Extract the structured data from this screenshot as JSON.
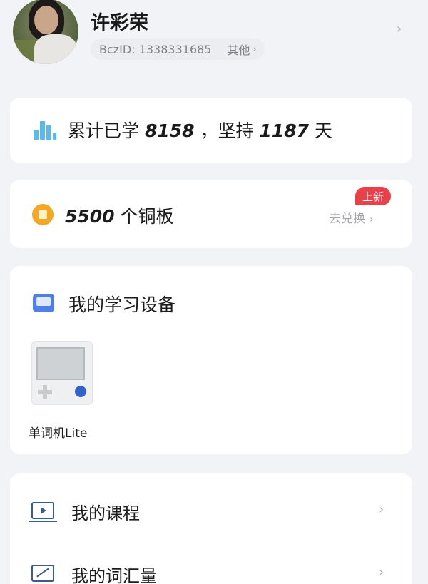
{
  "profile": {
    "name": "许彩荣",
    "id_label": "BczID: 1338331685",
    "other_label": "其他"
  },
  "stats": {
    "prefix": "累计已学",
    "learned": "8158",
    "middle": "，坚持",
    "days": "1187",
    "suffix": "天"
  },
  "coins": {
    "amount": "5500",
    "unit": "个铜板",
    "badge": "上新",
    "exchange_label": "去兑换"
  },
  "devices": {
    "title": "我的学习设备",
    "items": [
      {
        "label": "单词机Lite"
      }
    ]
  },
  "menu": {
    "items": [
      {
        "label": "我的课程"
      },
      {
        "label": "我的词汇量"
      }
    ]
  },
  "colors": {
    "accent_blue": "#4f7fe6",
    "coin": "#f5a623",
    "badge_red": "#e8414a",
    "stats_icon": "#5cb8e8"
  },
  "icons": [
    "chevron-right-icon",
    "bar-chart-icon",
    "coin-icon",
    "device-icon",
    "course-icon",
    "vocabulary-icon"
  ]
}
